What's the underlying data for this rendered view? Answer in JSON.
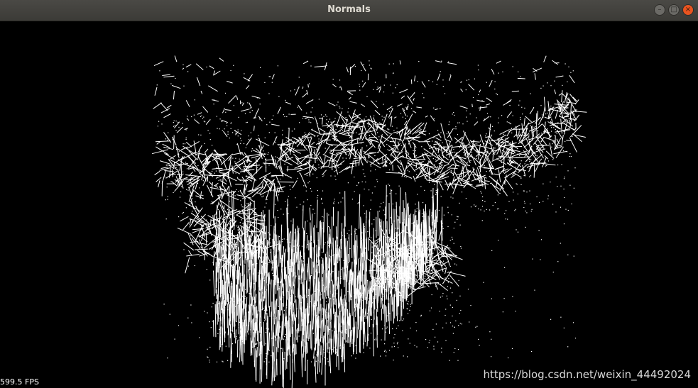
{
  "window": {
    "title": "Normals",
    "controls": {
      "minimize_icon": "minimize-icon",
      "maximize_icon": "maximize-icon",
      "close_icon": "close-icon"
    }
  },
  "viewport": {
    "fps_text": "599.5 FPS",
    "watermark": "https://blog.csdn.net/weixin_44492024",
    "background_color": "#000000",
    "point_color": "#ffffff"
  }
}
